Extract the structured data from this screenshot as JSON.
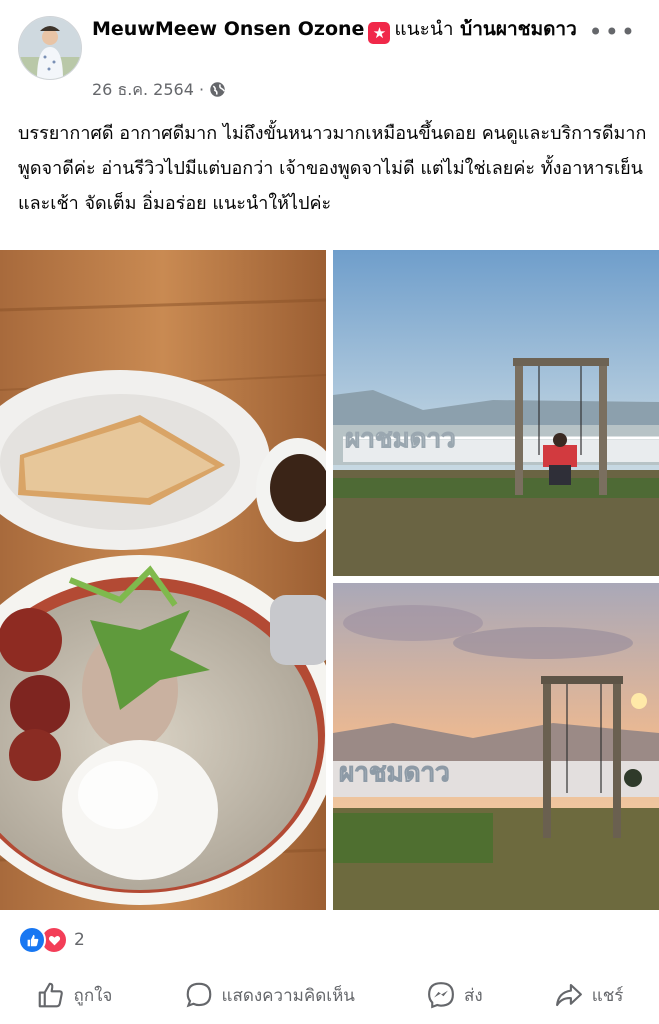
{
  "post": {
    "author": "MeuwMeew Onsen Ozone",
    "recommend_label": "แนะนำ",
    "place": "บ้านผาชมดาว",
    "date": "26 ธ.ค. 2564",
    "separator": "·",
    "more_icon": "more-dots-icon",
    "text": "บรรยากาศดี อากาศดีมาก  ไม่ถึงขั้นหนาวมากเหมือนขึ้นดอย คนดูและบริการดีมาก พูดจาดีค่ะ อ่านรีวิวไปมีแต่บอกว่า เจ้าของพูดจาไม่ดี แต่ไม่ใช่เลยค่ะ ทั้งอาหารเย็นและเช้า จัดเต็ม อิ่มอร่อย แนะนำให้ไปค่ะ",
    "photo_sign_text": "ผาชมดาว"
  },
  "reactions": {
    "count": "2",
    "colors": {
      "like": "#1877f2",
      "love": "#f33e58"
    }
  },
  "actions": {
    "like": "ถูกใจ",
    "comment": "แสดงความคิดเห็น",
    "send": "ส่ง",
    "share": "แชร์"
  },
  "colors": {
    "badge": "#f02849",
    "secondary_text": "#65676b"
  }
}
